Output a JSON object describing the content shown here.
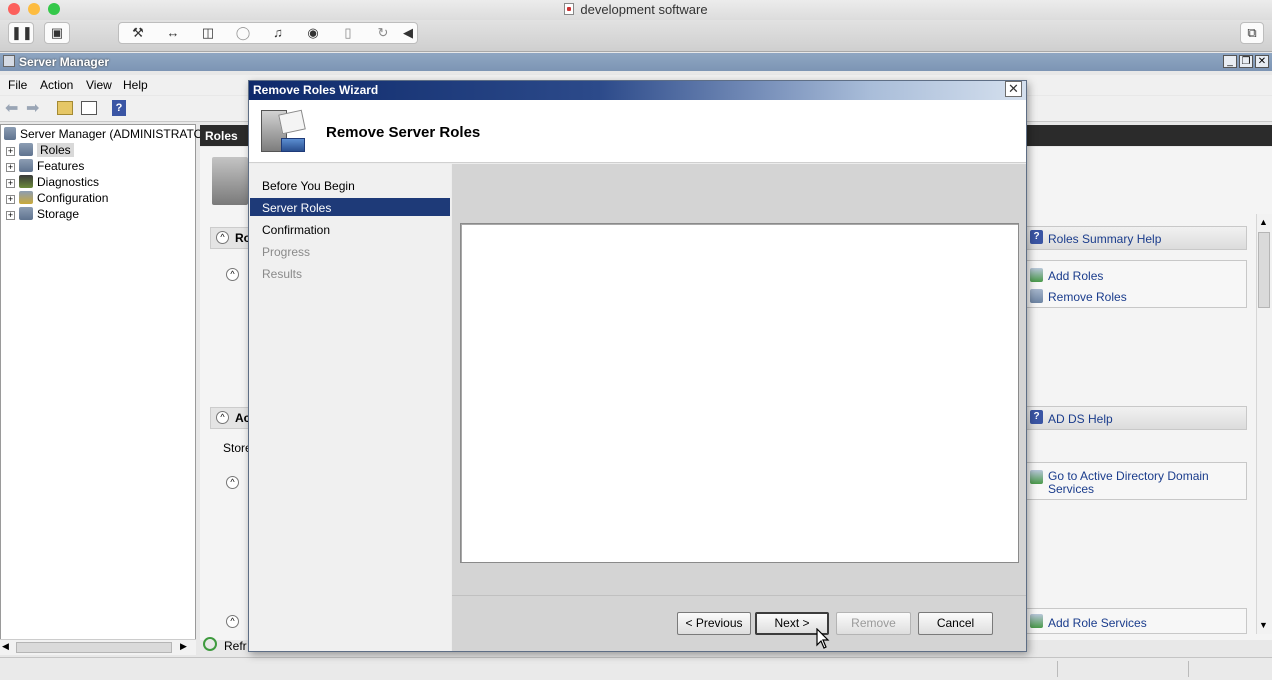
{
  "host": {
    "title": "development software",
    "toolbar_icons": [
      "pause-icon",
      "snapshot-icon",
      "wrench-icon",
      "network-icon",
      "usb-icon",
      "lock-icon",
      "sound-icon",
      "camera-icon",
      "mouse-icon",
      "sync-icon",
      "collapse-arrow-icon",
      "window-icon"
    ],
    "colors": {
      "close": "#fc605c",
      "minimize": "#fdbc40",
      "zoom": "#34c84a"
    }
  },
  "server_manager": {
    "title": "Server Manager",
    "menu": [
      "File",
      "Action",
      "View",
      "Help"
    ],
    "tree": {
      "root": "Server Manager (ADMINISTRATOR",
      "items": [
        "Roles",
        "Features",
        "Diagnostics",
        "Configuration",
        "Storage"
      ]
    },
    "center": {
      "header": "Roles",
      "section1_label": "Ro",
      "section2_label": "Ac",
      "section2_text": "Store",
      "refresh_label": "Refr"
    },
    "right_pane": {
      "roles_summary_help": "Roles Summary Help",
      "add_roles": "Add Roles",
      "remove_roles": "Remove Roles",
      "ad_ds_help": "AD DS Help",
      "go_to_ad_ds": "Go to Active Directory Domain Services",
      "add_role_services": "Add Role Services"
    }
  },
  "wizard": {
    "title": "Remove Roles Wizard",
    "heading": "Remove Server Roles",
    "nav": [
      {
        "label": "Before You Begin",
        "state": "normal"
      },
      {
        "label": "Server Roles",
        "state": "selected"
      },
      {
        "label": "Confirmation",
        "state": "normal"
      },
      {
        "label": "Progress",
        "state": "disabled"
      },
      {
        "label": "Results",
        "state": "disabled"
      }
    ],
    "buttons": {
      "previous": "< Previous",
      "next": "Next >",
      "remove": "Remove",
      "cancel": "Cancel"
    },
    "colors": {
      "selection": "#1e3a78",
      "title_bar": "#0e2a6b"
    }
  }
}
